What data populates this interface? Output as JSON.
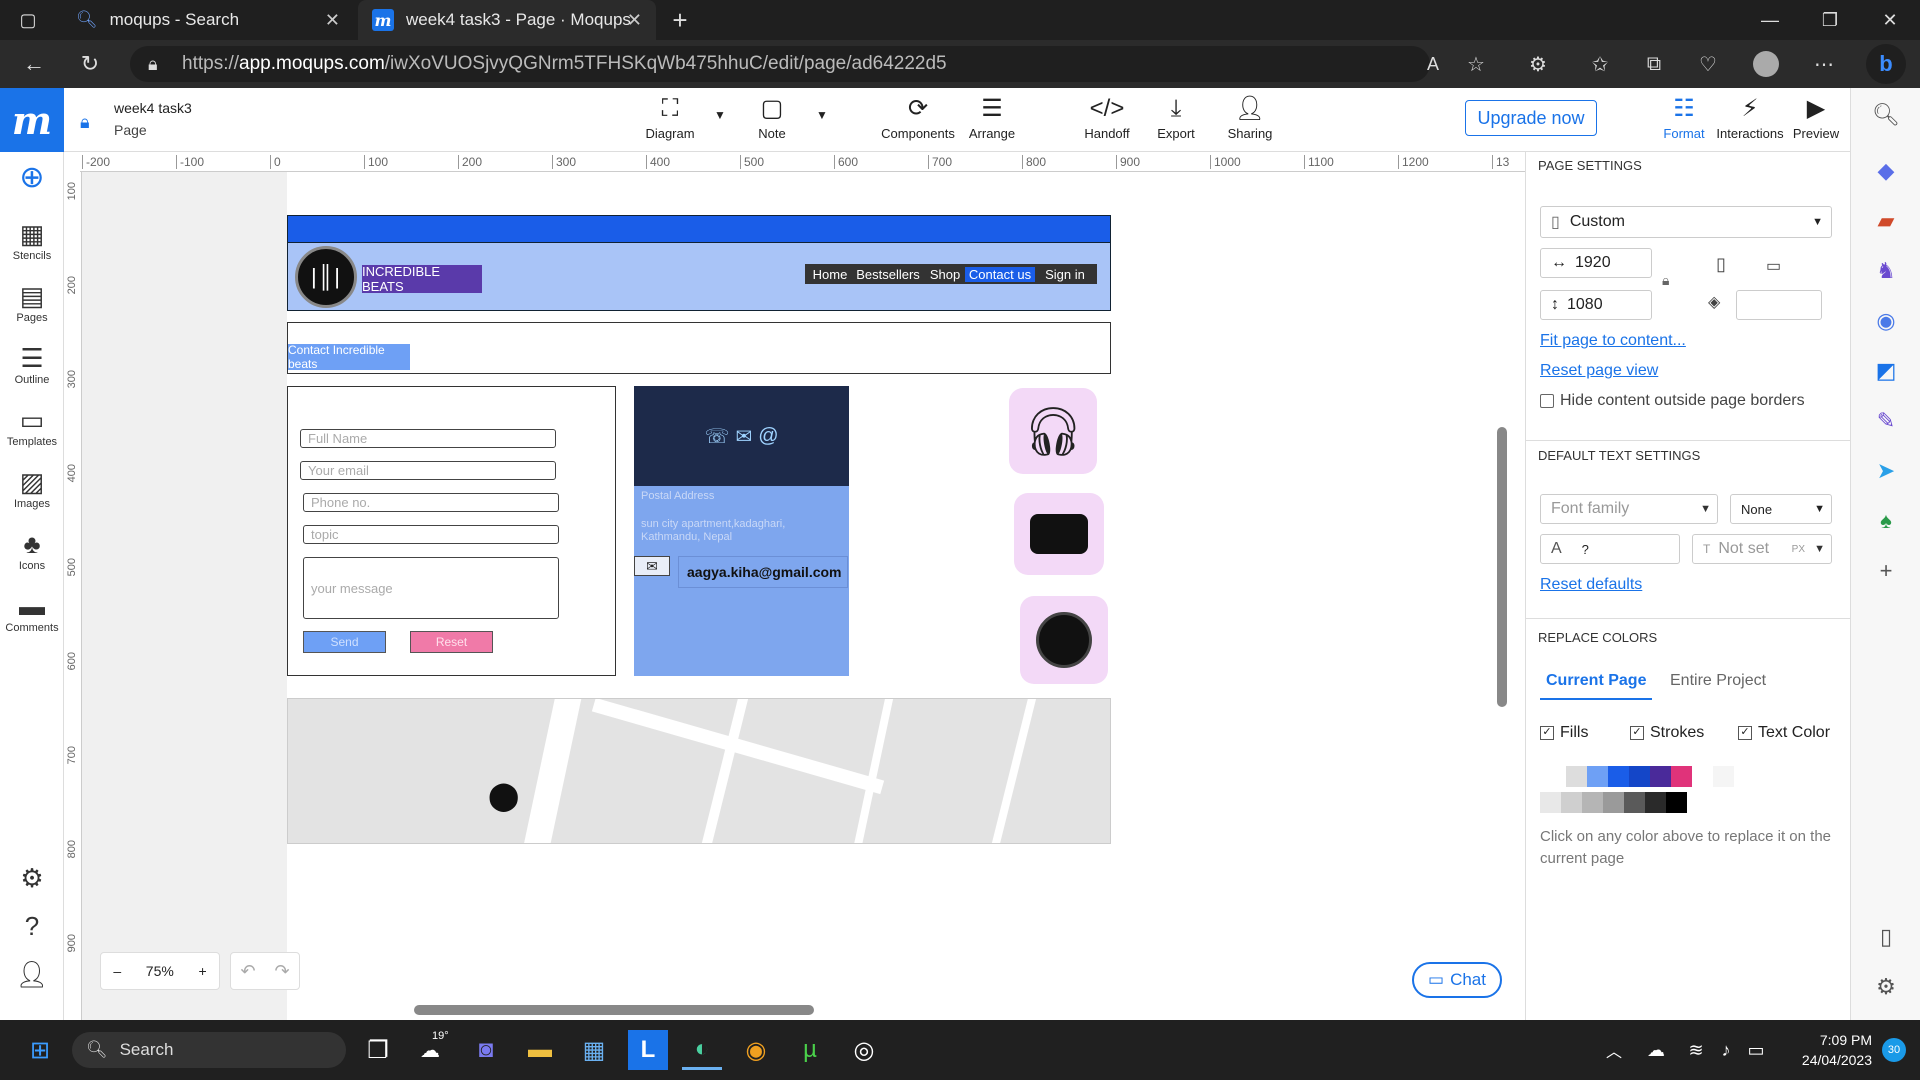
{
  "browser": {
    "tabs": [
      {
        "title": "moqups - Search",
        "active": false
      },
      {
        "title": "week4 task3 - Page · Moqups",
        "active": true
      }
    ],
    "url_prefix": "https://",
    "url_host": "app.moqups.com",
    "url_path": "/iwXoVUOSjvyQGNrm5TFHSKqWb475hhuC/edit/page/ad64222d5"
  },
  "app": {
    "logo": "m",
    "project": "week4 task3",
    "page_label": "Page",
    "toolbar": [
      {
        "label": "Diagram",
        "icon": "diagram-icon"
      },
      {
        "label": "Note",
        "icon": "note-icon"
      },
      {
        "label": "Components",
        "icon": "components-icon"
      },
      {
        "label": "Arrange",
        "icon": "arrange-icon"
      },
      {
        "label": "Handoff",
        "icon": "code-icon"
      },
      {
        "label": "Export",
        "icon": "download-icon"
      },
      {
        "label": "Sharing",
        "icon": "add-user-icon"
      }
    ],
    "upgrade": "Upgrade now",
    "right_tools": [
      {
        "label": "Format",
        "icon": "sliders-icon"
      },
      {
        "label": "Interactions",
        "icon": "lightning-icon"
      },
      {
        "label": "Preview",
        "icon": "play-icon"
      }
    ]
  },
  "leftrail": {
    "items": [
      "Stencils",
      "Pages",
      "Outline",
      "Templates",
      "Images",
      "Icons",
      "Comments"
    ]
  },
  "rulers": {
    "h": [
      "-200",
      "-100",
      "0",
      "100",
      "200",
      "300",
      "400",
      "500",
      "600",
      "700",
      "800",
      "900",
      "1000",
      "1100",
      "1200",
      "13"
    ],
    "v": [
      "100",
      "200",
      "300",
      "400",
      "500",
      "600",
      "700",
      "800",
      "900"
    ]
  },
  "mockup": {
    "brand": "INCREDIBLE BEATS",
    "nav": [
      "Home",
      "Bestsellers",
      "Shop",
      "Contact us",
      "Sign in"
    ],
    "contact_title": "Contact Incredible beats",
    "form": {
      "full_name": "Full Name",
      "email": "Your email",
      "phone": "Phone no.",
      "topic": "topic",
      "message": "your message",
      "send": "Send",
      "reset": "Reset"
    },
    "postal_label": "Postal Address",
    "address": "sun city apartment,kadaghari, Kathmandu, Nepal",
    "email": "aagya.kiha@gmail.com"
  },
  "zoom": {
    "value": "75%",
    "minus": "–",
    "plus": "+"
  },
  "chat": "Chat",
  "panel": {
    "page_settings": "PAGE SETTINGS",
    "preset": "Custom",
    "width": "1920",
    "height": "1080",
    "fit": "Fit page to content...",
    "reset_view": "Reset page view",
    "hide_outside": "Hide content outside page borders",
    "default_text": "DEFAULT TEXT SETTINGS",
    "font_family": "Font family",
    "style": "None",
    "size_q": "?",
    "not_set": "Not set",
    "px": "PX",
    "reset_defaults": "Reset defaults",
    "replace_colors": "REPLACE COLORS",
    "tab_current": "Current Page",
    "tab_entire": "Entire Project",
    "fills": "Fills",
    "strokes": "Strokes",
    "text_color": "Text Color",
    "hint": "Click on any color above to replace it on the current page",
    "swatches_row1": [
      "#dddddd",
      "#6ea0f5",
      "#1a5de8",
      "#1446c8",
      "#4a2a9a",
      "#e0337a",
      "#ffffff",
      "#f5f5f5"
    ],
    "swatches_row2": [
      "#e8e8e8",
      "#cfcfcf",
      "#b5b5b5",
      "#9a9a9a",
      "#5a5a5a",
      "#2a2a2a",
      "#000000"
    ]
  },
  "taskbar": {
    "search": "Search",
    "weather": "19°",
    "time": "7:09 PM",
    "date": "24/04/2023",
    "notif": "30"
  }
}
